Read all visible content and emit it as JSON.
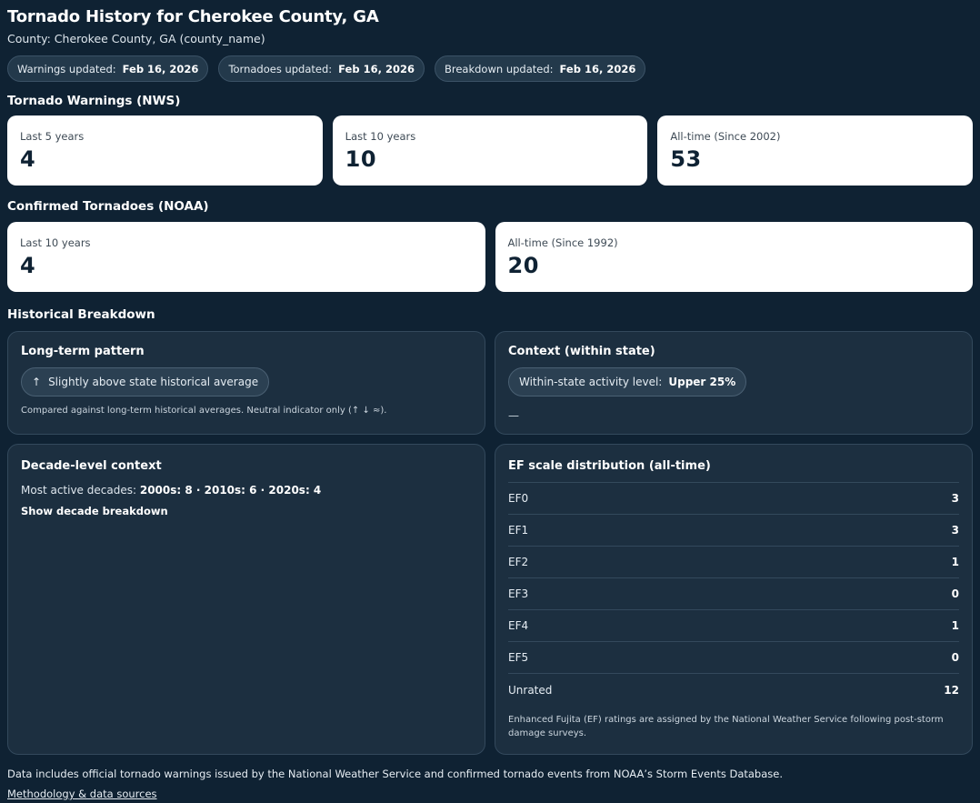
{
  "header": {
    "title": "Tornado History for Cherokee County, GA",
    "subtitle": "County: Cherokee County, GA (county_name)"
  },
  "updates": [
    {
      "label": "Warnings updated:",
      "date": "Feb 16, 2026"
    },
    {
      "label": "Tornadoes updated:",
      "date": "Feb 16, 2026"
    },
    {
      "label": "Breakdown updated:",
      "date": "Feb 16, 2026"
    }
  ],
  "warnings": {
    "heading": "Tornado Warnings (NWS)",
    "cards": [
      {
        "label": "Last 5 years",
        "value": "4"
      },
      {
        "label": "Last 10 years",
        "value": "10"
      },
      {
        "label": "All-time (Since 2002)",
        "value": "53"
      }
    ]
  },
  "tornadoes": {
    "heading": "Confirmed Tornadoes (NOAA)",
    "cards": [
      {
        "label": "Last 10 years",
        "value": "4"
      },
      {
        "label": "All-time (Since 1992)",
        "value": "20"
      }
    ]
  },
  "breakdown": {
    "heading": "Historical Breakdown",
    "long_term": {
      "title": "Long-term pattern",
      "arrow": "↑",
      "indicator": "Slightly above state historical average",
      "note": "Compared against long-term historical averages. Neutral indicator only (↑ ↓ ≈)."
    },
    "context": {
      "title": "Context (within state)",
      "label": "Within-state activity level:",
      "value": "Upper 25%",
      "dash": "—"
    },
    "decade": {
      "title": "Decade-level context",
      "prefix": "Most active decades:",
      "values": "2000s: 8 · 2010s: 6 · 2020s: 4",
      "toggle": "Show decade breakdown"
    },
    "ef": {
      "title": "EF scale distribution (all-time)",
      "rows": [
        {
          "label": "EF0",
          "value": "3"
        },
        {
          "label": "EF1",
          "value": "3"
        },
        {
          "label": "EF2",
          "value": "1"
        },
        {
          "label": "EF3",
          "value": "0"
        },
        {
          "label": "EF4",
          "value": "1"
        },
        {
          "label": "EF5",
          "value": "0"
        },
        {
          "label": "Unrated",
          "value": "12"
        }
      ],
      "note": "Enhanced Fujita (EF) ratings are assigned by the National Weather Service following post-storm damage surveys."
    }
  },
  "footer": {
    "note": "Data includes official tornado warnings issued by the National Weather Service and confirmed tornado events from NOAA’s Storm Events Database.",
    "link": "Methodology & data sources"
  }
}
